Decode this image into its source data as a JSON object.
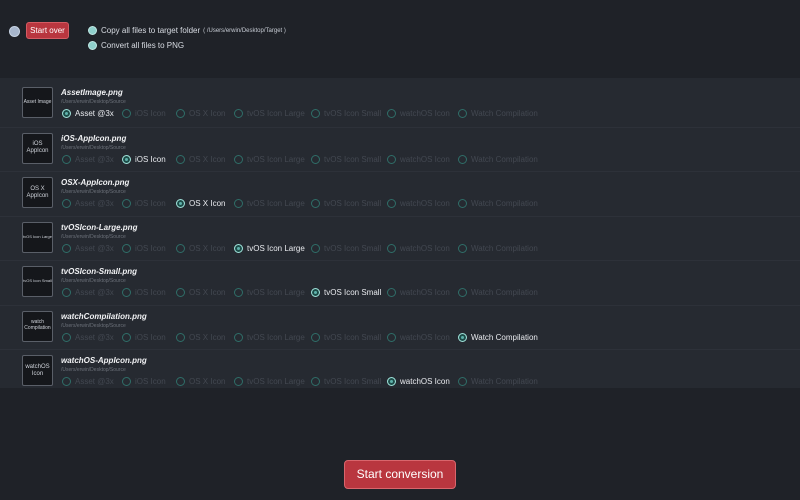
{
  "toolbar": {
    "start_over_label": "Start over",
    "option_copy_label": "Copy all files to target folder",
    "option_copy_path": "( /Users/erwin/Desktop/Target )",
    "option_convert_label": "Convert all files to PNG"
  },
  "radio_labels": [
    "Asset @3x",
    "iOS Icon",
    "OS X Icon",
    "tvOS Icon Large",
    "tvOS Icon Small",
    "watchOS Icon",
    "Watch Compilation"
  ],
  "files": [
    {
      "name": "AssetImage.png",
      "path": "/Users/erwin/Desktop/Source",
      "thumb_label": "Asset Image",
      "selected": 0
    },
    {
      "name": "iOS-AppIcon.png",
      "path": "/Users/erwin/Desktop/Source",
      "thumb_label": "iOS AppIcon",
      "selected": 1
    },
    {
      "name": "OSX-AppIcon.png",
      "path": "/Users/erwin/Desktop/Source",
      "thumb_label": "OS X AppIcon",
      "selected": 2
    },
    {
      "name": "tvOSIcon-Large.png",
      "path": "/Users/erwin/Desktop/Source",
      "thumb_label": "tvOS Icon Large",
      "selected": 3
    },
    {
      "name": "tvOSIcon-Small.png",
      "path": "/Users/erwin/Desktop/Source",
      "thumb_label": "tvOS Icon Small",
      "selected": 4
    },
    {
      "name": "watchCompilation.png",
      "path": "/Users/erwin/Desktop/Source",
      "thumb_label": "watch Compilation",
      "selected": 6
    },
    {
      "name": "watchOS-AppIcon.png",
      "path": "/Users/erwin/Desktop/Source",
      "thumb_label": "watchOS Icon",
      "selected": 5
    }
  ],
  "footer": {
    "convert_label": "Start conversion"
  },
  "colors": {
    "accent": "#b9363f",
    "radio_selected": "#5fb2ab",
    "background": "#1f2228"
  }
}
